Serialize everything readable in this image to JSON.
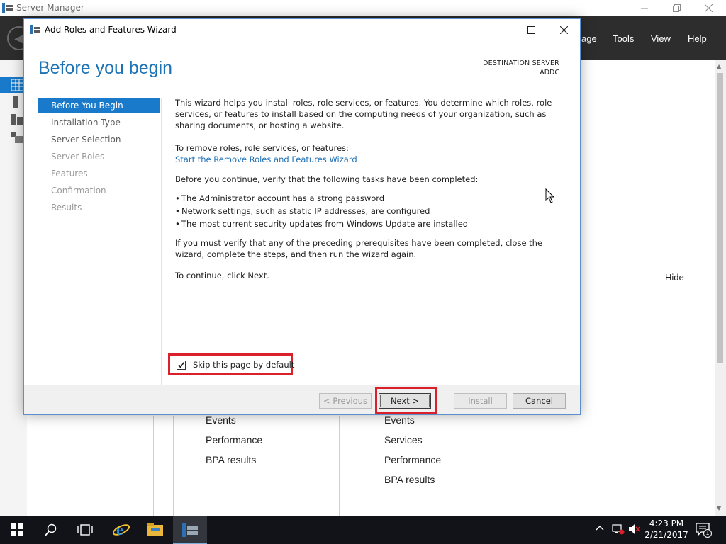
{
  "server_manager": {
    "title": "Server Manager",
    "menu": [
      "age",
      "Tools",
      "View",
      "Help"
    ],
    "hide_label": "Hide",
    "tile_left_items": [
      "Events",
      "Performance",
      "BPA results"
    ],
    "tile_right_items": [
      "Events",
      "Services",
      "Performance",
      "BPA results"
    ]
  },
  "wizard": {
    "title": "Add Roles and Features Wizard",
    "heading": "Before you begin",
    "destination_label": "DESTINATION SERVER",
    "destination_value": "ADDC",
    "steps": [
      {
        "label": "Before You Begin",
        "state": "active"
      },
      {
        "label": "Installation Type",
        "state": "enabled"
      },
      {
        "label": "Server Selection",
        "state": "enabled"
      },
      {
        "label": "Server Roles",
        "state": "disabled"
      },
      {
        "label": "Features",
        "state": "disabled"
      },
      {
        "label": "Confirmation",
        "state": "disabled"
      },
      {
        "label": "Results",
        "state": "disabled"
      }
    ],
    "intro": "This wizard helps you install roles, role services, or features. You determine which roles, role services, or features to install based on the computing needs of your organization, such as sharing documents, or hosting a website.",
    "remove_text": "To remove roles, role services, or features:",
    "remove_link": "Start the Remove Roles and Features Wizard",
    "verify_text": "Before you continue, verify that the following tasks have been completed:",
    "bullets": [
      "The Administrator account has a strong password",
      "Network settings, such as static IP addresses, are configured",
      "The most current security updates from Windows Update are installed"
    ],
    "prereq_text": "If you must verify that any of the preceding prerequisites have been completed, close the wizard, complete the steps, and then run the wizard again.",
    "continue_text": "To continue, click Next.",
    "skip_label": "Skip this page by default",
    "skip_checked": true,
    "buttons": {
      "previous": "< Previous",
      "next": "Next >",
      "install": "Install",
      "cancel": "Cancel"
    }
  },
  "taskbar": {
    "time": "4:23 PM",
    "date": "2/21/2017",
    "notification_count": "1"
  },
  "colors": {
    "accent": "#1979ca",
    "heading": "#1e73b4",
    "highlight_red": "#d9202b",
    "menubar": "#2d2d2d"
  }
}
